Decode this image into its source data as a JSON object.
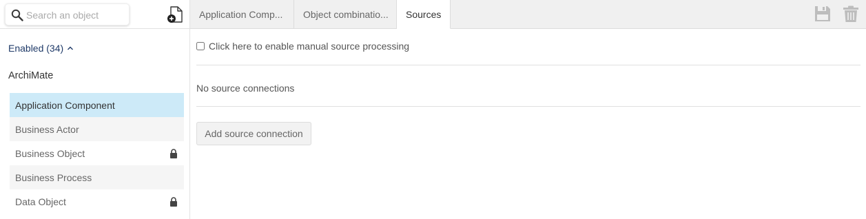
{
  "search": {
    "placeholder": "Search an object"
  },
  "sidebar": {
    "enabled_label": "Enabled (34)",
    "group_heading": "ArchiMate",
    "items": [
      {
        "label": "Application Component",
        "locked": false
      },
      {
        "label": "Business Actor",
        "locked": false
      },
      {
        "label": "Business Object",
        "locked": true
      },
      {
        "label": "Business Process",
        "locked": false
      },
      {
        "label": "Data Object",
        "locked": true
      }
    ]
  },
  "tabs": [
    {
      "label": "Application Comp..."
    },
    {
      "label": "Object combinatio..."
    },
    {
      "label": "Sources"
    }
  ],
  "main": {
    "manual_processing_label": "Click here to enable manual source processing",
    "no_sources_text": "No source connections",
    "add_source_label": "Add source connection"
  },
  "colors": {
    "selected_item_bg": "#cdeaf8",
    "enabled_link": "#1f3a68",
    "tab_bar_bg": "#f0f0f0"
  },
  "icons": [
    "search-icon",
    "new-object-icon",
    "chevron-up-icon",
    "lock-icon",
    "save-icon",
    "trash-icon"
  ]
}
